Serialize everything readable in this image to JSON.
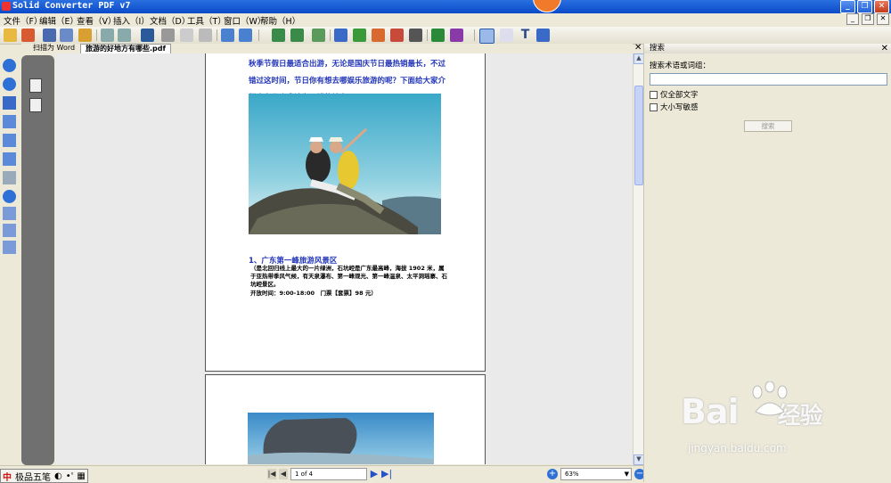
{
  "window": {
    "title": "Solid Converter PDF v7"
  },
  "menu": [
    "文件（F）",
    "编辑（E）",
    "查看（V）",
    "插入（I）",
    "文档（D）",
    "工具（T）",
    "窗口（W）",
    "帮助（H）"
  ],
  "tabs": {
    "word": "扫描为 Word",
    "pdf": "旅游的好地方有哪些.pdf"
  },
  "document": {
    "intro": "秋季节假日最适合出游，无论是国庆节日最热销最长，不过错过这时间，节日你有想去哪娱乐旅游的呢？下面给大家介绍广东几个我认为不错的地方。",
    "section_title": "1、广东第一峰旅游风景区",
    "section_desc": "（是北回归线上最大的一片绿洲，石坑崆是广东最高峰，海拔 1902 米，属于亚热带季风气候，有天泉瀑布、第一峰观光、第一峰温泉、太平洞瑶寨、石坑崆景区。",
    "hours": "开放时间：9:00-18:00　门票【套票】98 元）"
  },
  "status": {
    "page_indicator": "1 of 4",
    "zoom": "63%"
  },
  "ime": {
    "name": "极品五笔"
  },
  "search_panel": {
    "title": "搜索",
    "label": "搜索术语或词组：",
    "input_value": "",
    "option_whole": "仅全部文字",
    "option_case": "大小写敏感",
    "button": "搜索"
  },
  "watermark": {
    "brand": "Bai",
    "brand2": "经验",
    "url": "jingyan.baidu.com"
  },
  "colors": {
    "title_bar": "#0a4ac8",
    "doc_blue_text": "#2235b8",
    "left_panel": "#707070"
  }
}
